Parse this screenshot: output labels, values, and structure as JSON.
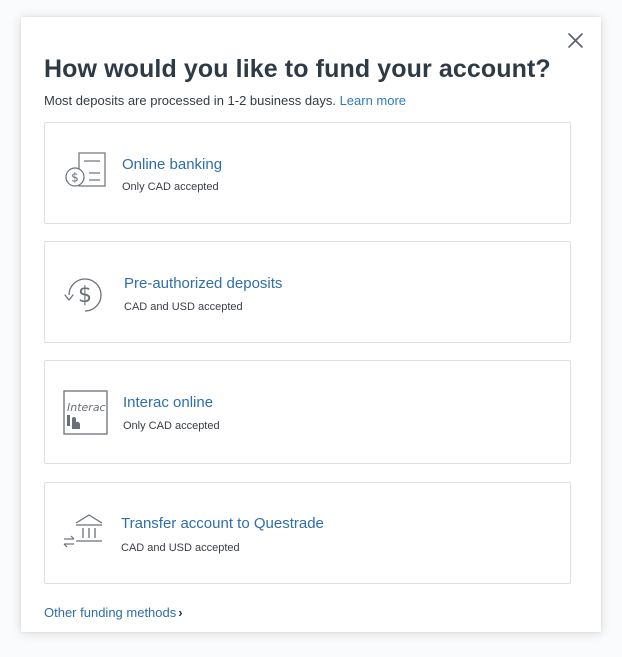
{
  "dialog": {
    "title": "How would you like to fund your account?",
    "subtitle": "Most deposits are processed in 1-2 business days.",
    "learn_more": "Learn more",
    "close_icon": "close-icon"
  },
  "options": [
    {
      "title": "Online banking",
      "subtitle": "Only CAD accepted",
      "icon": "online-banking-icon"
    },
    {
      "title": "Pre-authorized deposits",
      "subtitle": "CAD and USD accepted",
      "icon": "recurring-dollar-icon"
    },
    {
      "title": "Interac online",
      "subtitle": "Only CAD accepted",
      "icon": "interac-logo",
      "logo_text": "Interac"
    },
    {
      "title": "Transfer account to Questrade",
      "subtitle": "CAD and USD accepted",
      "icon": "bank-transfer-icon"
    }
  ],
  "footer": {
    "other_methods": "Other funding methods",
    "chevron": "›"
  },
  "colors": {
    "link": "#2f6ea8",
    "title": "#2e3a45",
    "border": "#dde1e5"
  }
}
